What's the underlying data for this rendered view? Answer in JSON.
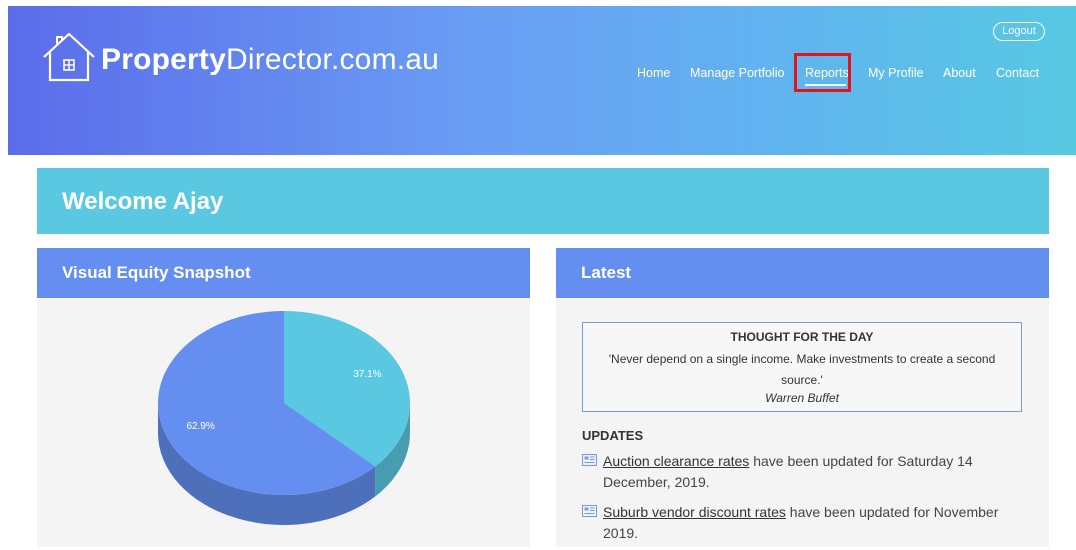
{
  "brand": {
    "name_bold": "Property",
    "name_light": "Director.com.au"
  },
  "header": {
    "logout_label": "Logout",
    "nav": {
      "home": "Home",
      "manage_portfolio": "Manage Portfolio",
      "reports": "Reports",
      "my_profile": "My Profile",
      "about": "About",
      "contact": "Contact"
    },
    "highlight_color": "#e3141c"
  },
  "welcome": {
    "title": "Welcome Ajay"
  },
  "equity_panel": {
    "title": "Visual Equity Snapshot"
  },
  "chart_data": {
    "type": "pie",
    "values": [
      37.1,
      62.9
    ],
    "labels": [
      "37.1%",
      "62.9%"
    ],
    "colors": [
      "#5ac8e1",
      "#648ff0"
    ]
  },
  "latest_panel": {
    "title": "Latest",
    "thought": {
      "title": "THOUGHT FOR THE DAY",
      "quote": "'Never depend on a single income. Make investments to create a second source.'",
      "author": "Warren Buffet"
    },
    "updates_title": "UPDATES",
    "updates": [
      {
        "link": "Auction clearance rates",
        "text": " have been updated for Saturday 14 December, 2019."
      },
      {
        "link": "Suburb vendor discount rates",
        "text": " have been updated for November 2019."
      }
    ]
  },
  "colors": {
    "header_gradient_start": "#5b6cea",
    "header_gradient_end": "#57c9e2",
    "welcome_bg": "#5ac8e1",
    "panel_head_bg": "#648ff0"
  }
}
